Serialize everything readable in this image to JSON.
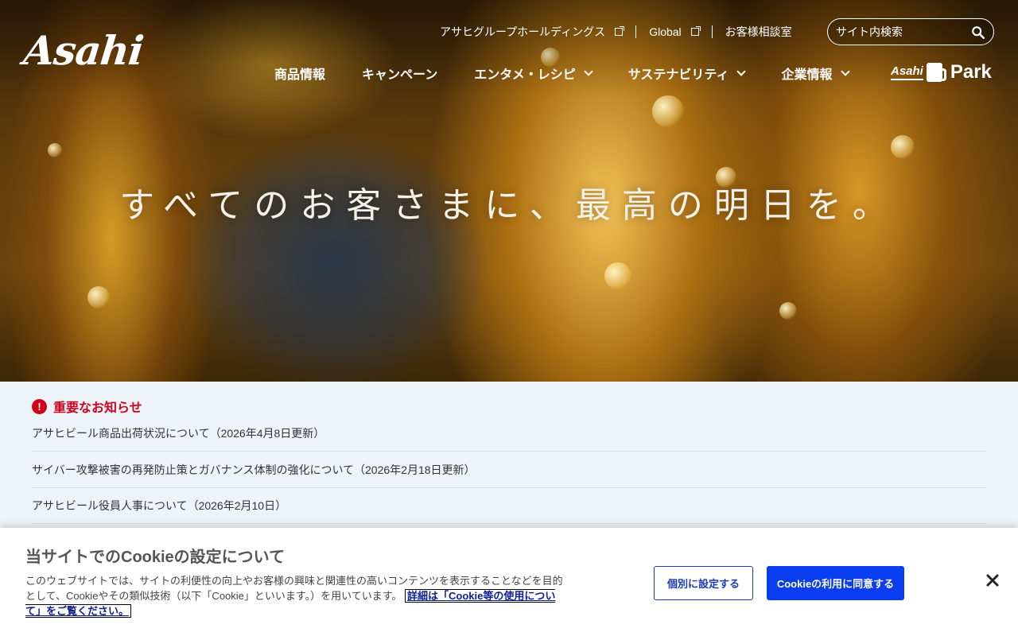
{
  "header": {
    "logo_text": "Asahi",
    "util_links": [
      {
        "label": "アサヒグループホールディングス",
        "external": true
      },
      {
        "label": "Global",
        "external": true
      },
      {
        "label": "お客様相談室",
        "external": false
      }
    ],
    "search": {
      "placeholder": "サイト内検索"
    },
    "nav": [
      {
        "label": "商品情報"
      },
      {
        "label": "キャンペーン"
      },
      {
        "label": "エンタメ・レシピ"
      },
      {
        "label": "サステナビリティ"
      },
      {
        "label": "企業情報"
      }
    ],
    "park_logo": {
      "left": "Asahi",
      "right": "Park"
    }
  },
  "hero": {
    "catchphrase": "すべてのお客さまに、最高の明日を。"
  },
  "news": {
    "heading": "重要なお知らせ",
    "items": [
      "アサヒビール商品出荷状況について（2026年4月8日更新）",
      "サイバー攻撃被害の再発防止策とガバナンス体制の強化について（2026年2月18日更新）",
      "アサヒビール役員人事について（2026年2月10日）"
    ]
  },
  "cookie": {
    "title": "当サイトでのCookieの設定について",
    "description": "このウェブサイトでは、サイトの利便性の向上やお客様の興味と関連性の高いコンテンツを表示することなどを目的として、Cookieやその類似技術（以下「Cookie」といいます。）を用いています。",
    "link_text": "詳細は「Cookie等の使用について」をご覧ください。",
    "btn_settings": "個別に設定する",
    "btn_accept": "Cookieの利用に同意する"
  },
  "colors": {
    "alert_red": "#d0021b",
    "accept_blue": "#0a3cf0",
    "settings_border": "#1b3bb8"
  }
}
